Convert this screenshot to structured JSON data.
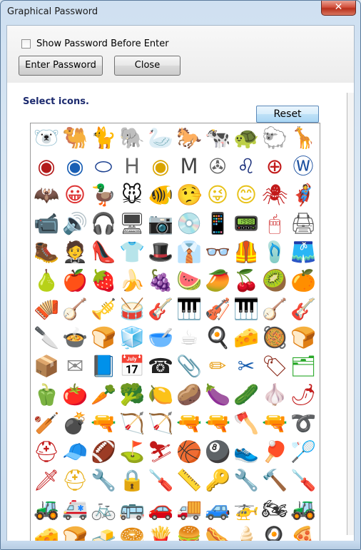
{
  "window": {
    "title": "Graphical Password",
    "close_glyph": "✕"
  },
  "controls": {
    "show_password_label": "Show Password Before Enter",
    "show_password_checked": false,
    "enter_label": "Enter Password",
    "close_label": "Close"
  },
  "panel": {
    "select_label": "Select icons.",
    "reset_label": "Reset"
  },
  "icons": [
    {
      "name": "polar-bear-icon",
      "glyph": "🐻‍❄️",
      "color": "#777"
    },
    {
      "name": "camel-icon",
      "glyph": "🐫",
      "color": "#8a5a2b"
    },
    {
      "name": "cat-icon",
      "glyph": "🐈",
      "color": "#888"
    },
    {
      "name": "elephant-icon",
      "glyph": "🐘",
      "color": "#888"
    },
    {
      "name": "swan-icon",
      "glyph": "🦢",
      "color": "#999"
    },
    {
      "name": "horse-icon",
      "glyph": "🐎",
      "color": "#5a3a1a"
    },
    {
      "name": "cow-icon",
      "glyph": "🐄",
      "color": "#222"
    },
    {
      "name": "turtle-icon",
      "glyph": "🐢",
      "color": "#3a7a2a"
    },
    {
      "name": "sheep-icon",
      "glyph": "🐑",
      "color": "#999"
    },
    {
      "name": "giraffe-icon",
      "glyph": "🦒",
      "color": "#c08a2a"
    },
    {
      "name": "alfa-romeo-logo-icon",
      "glyph": "◉",
      "color": "#b31b1b"
    },
    {
      "name": "bmw-logo-icon",
      "glyph": "◉",
      "color": "#1a5fb4"
    },
    {
      "name": "ford-logo-icon",
      "glyph": "⬭",
      "color": "#1a3f8f"
    },
    {
      "name": "honda-logo-icon",
      "glyph": "H",
      "color": "#666"
    },
    {
      "name": "lotus-logo-icon",
      "glyph": "◉",
      "color": "#d9a400"
    },
    {
      "name": "mazda-logo-icon",
      "glyph": "M",
      "color": "#444"
    },
    {
      "name": "mercedes-logo-icon",
      "glyph": "✇",
      "color": "#666"
    },
    {
      "name": "peugeot-logo-icon",
      "glyph": "♌",
      "color": "#1a2f7a"
    },
    {
      "name": "toyota-logo-icon",
      "glyph": "⊕",
      "color": "#c21a1a"
    },
    {
      "name": "volkswagen-logo-icon",
      "glyph": "Ⓦ",
      "color": "#1a4f9f"
    },
    {
      "name": "batman-icon",
      "glyph": "🦇",
      "color": "#111"
    },
    {
      "name": "cartman-icon",
      "glyph": "😀",
      "color": "#d33"
    },
    {
      "name": "donald-duck-icon",
      "glyph": "🦆",
      "color": "#2a5fb0"
    },
    {
      "name": "mickey-mouse-icon",
      "glyph": "🐭",
      "color": "#111"
    },
    {
      "name": "nemo-fish-icon",
      "glyph": "🐠",
      "color": "#e8671a"
    },
    {
      "name": "pinocchio-icon",
      "glyph": "🤥",
      "color": "#c5741a"
    },
    {
      "name": "bart-simpson-icon",
      "glyph": "😜",
      "color": "#e8c21a"
    },
    {
      "name": "lisa-simpson-icon",
      "glyph": "😊",
      "color": "#e8c21a"
    },
    {
      "name": "spiderman-icon",
      "glyph": "🕷",
      "color": "#c21a1a"
    },
    {
      "name": "superman-icon",
      "glyph": "🦸",
      "color": "#1a4fb0"
    },
    {
      "name": "camcorder-icon",
      "glyph": "📹",
      "color": "#333"
    },
    {
      "name": "speakers-icon",
      "glyph": "🔊",
      "color": "#222"
    },
    {
      "name": "headphones-icon",
      "glyph": "🎧",
      "color": "#333"
    },
    {
      "name": "monitor-icon",
      "glyph": "🖥",
      "color": "#444"
    },
    {
      "name": "camera-icon",
      "glyph": "📷",
      "color": "#222"
    },
    {
      "name": "cd-icon",
      "glyph": "💿",
      "color": "#aaa"
    },
    {
      "name": "ipod-icon",
      "glyph": "📱",
      "color": "#ccc"
    },
    {
      "name": "phone-icon",
      "glyph": "📟",
      "color": "#333"
    },
    {
      "name": "mouse-icon",
      "glyph": "🖱",
      "color": "#c22"
    },
    {
      "name": "printer-icon",
      "glyph": "🖨",
      "color": "#555"
    },
    {
      "name": "boot-icon",
      "glyph": "🥾",
      "color": "#333"
    },
    {
      "name": "tuxedo-icon",
      "glyph": "🤵",
      "color": "#111"
    },
    {
      "name": "high-heel-icon",
      "glyph": "👠",
      "color": "#111"
    },
    {
      "name": "shirt-icon",
      "glyph": "👕",
      "color": "#ccc"
    },
    {
      "name": "hat-icon",
      "glyph": "🎩",
      "color": "#6a3a1a"
    },
    {
      "name": "tie-icon",
      "glyph": "👔",
      "color": "#8a1a1a"
    },
    {
      "name": "glasses-icon",
      "glyph": "👓",
      "color": "#666"
    },
    {
      "name": "life-vest-icon",
      "glyph": "🦺",
      "color": "#f08a1a"
    },
    {
      "name": "flip-flops-icon",
      "glyph": "🩴",
      "color": "#2aa82a"
    },
    {
      "name": "shorts-icon",
      "glyph": "🩳",
      "color": "#666"
    },
    {
      "name": "pear-icon",
      "glyph": "🍐",
      "color": "#b0a030"
    },
    {
      "name": "apple-icon",
      "glyph": "🍎",
      "color": "#c2441a"
    },
    {
      "name": "strawberry-icon",
      "glyph": "🍓",
      "color": "#c21a1a"
    },
    {
      "name": "banana-icon",
      "glyph": "🍌",
      "color": "#e8c21a"
    },
    {
      "name": "grapes-icon",
      "glyph": "🍇",
      "color": "#8a2a8a"
    },
    {
      "name": "watermelon-icon",
      "glyph": "🍉",
      "color": "#e8441a"
    },
    {
      "name": "papaya-icon",
      "glyph": "🥭",
      "color": "#e8a01a"
    },
    {
      "name": "cherries-icon",
      "glyph": "🍒",
      "color": "#8a1a1a"
    },
    {
      "name": "kiwi-icon",
      "glyph": "🥝",
      "color": "#6a8a1a"
    },
    {
      "name": "orange-icon",
      "glyph": "🍊",
      "color": "#f08a1a"
    },
    {
      "name": "accordion-icon",
      "glyph": "🪗",
      "color": "#333"
    },
    {
      "name": "banjo-icon",
      "glyph": "🪕",
      "color": "#8a5a2a"
    },
    {
      "name": "trumpet-icon",
      "glyph": "🎺",
      "color": "#222"
    },
    {
      "name": "drum-icon",
      "glyph": "🥁",
      "color": "#8a6a3a"
    },
    {
      "name": "guitar-icon",
      "glyph": "🎸",
      "color": "#c57a1a"
    },
    {
      "name": "keyboard-icon",
      "glyph": "🎹",
      "color": "#333"
    },
    {
      "name": "violin-icon",
      "glyph": "🎻",
      "color": "#8a3a1a"
    },
    {
      "name": "piano-icon",
      "glyph": "🎹",
      "color": "#111"
    },
    {
      "name": "lute-icon",
      "glyph": "🪕",
      "color": "#6a3a1a"
    },
    {
      "name": "mandolin-icon",
      "glyph": "🎸",
      "color": "#a05a1a"
    },
    {
      "name": "knife-icon",
      "glyph": "🔪",
      "color": "#555"
    },
    {
      "name": "pot-icon",
      "glyph": "🍲",
      "color": "#999"
    },
    {
      "name": "toaster-icon",
      "glyph": "🍞",
      "color": "#aaa"
    },
    {
      "name": "fridge-icon",
      "glyph": "🧊",
      "color": "#ccc"
    },
    {
      "name": "mixer-icon",
      "glyph": "🥣",
      "color": "#ccc"
    },
    {
      "name": "mug-icon",
      "glyph": "☕",
      "color": "#ccc"
    },
    {
      "name": "frying-pan-icon",
      "glyph": "🍳",
      "color": "#1a5fb0"
    },
    {
      "name": "grater-icon",
      "glyph": "🧀",
      "color": "#2aa82a"
    },
    {
      "name": "saucepan-icon",
      "glyph": "🥘",
      "color": "#999"
    },
    {
      "name": "toaster-oven-icon",
      "glyph": "🍞",
      "color": "#aaa"
    },
    {
      "name": "box-icon",
      "glyph": "📦",
      "color": "#8a2a1a"
    },
    {
      "name": "envelope-icon",
      "glyph": "✉",
      "color": "#888"
    },
    {
      "name": "book-icon",
      "glyph": "📘",
      "color": "#444"
    },
    {
      "name": "calendar-icon",
      "glyph": "📅",
      "color": "#c21a1a"
    },
    {
      "name": "telephone-icon",
      "glyph": "☎",
      "color": "#222"
    },
    {
      "name": "paper-clip-icon",
      "glyph": "📎",
      "color": "#999"
    },
    {
      "name": "pencil-icon",
      "glyph": "✏",
      "color": "#e8a01a"
    },
    {
      "name": "scissors-icon",
      "glyph": "✂",
      "color": "#1a5fb0"
    },
    {
      "name": "stamp-icon",
      "glyph": "🏷",
      "color": "#8a2a1a"
    },
    {
      "name": "stapler-icon",
      "glyph": "🗂",
      "color": "#2aa82a"
    },
    {
      "name": "bell-pepper-icon",
      "glyph": "🫑",
      "color": "#c21a1a"
    },
    {
      "name": "tomato-icon",
      "glyph": "🍅",
      "color": "#d22a1a"
    },
    {
      "name": "carrots-icon",
      "glyph": "🥕",
      "color": "#e8671a"
    },
    {
      "name": "cauliflower-icon",
      "glyph": "🥦",
      "color": "#bbb"
    },
    {
      "name": "lemon-icon",
      "glyph": "🍋",
      "color": "#c8c21a"
    },
    {
      "name": "potatoes-icon",
      "glyph": "🥔",
      "color": "#b08a3a"
    },
    {
      "name": "eggplant-icon",
      "glyph": "🍆",
      "color": "#3a1a4a"
    },
    {
      "name": "cucumber-icon",
      "glyph": "🥒",
      "color": "#2a8a2a"
    },
    {
      "name": "garlic-icon",
      "glyph": "🧄",
      "color": "#ccc"
    },
    {
      "name": "chili-icon",
      "glyph": "🌶",
      "color": "#c21a1a"
    },
    {
      "name": "baseball-bat-icon",
      "glyph": "🏏",
      "color": "#555"
    },
    {
      "name": "bomb-icon",
      "glyph": "💣",
      "color": "#111"
    },
    {
      "name": "rifle-icon",
      "glyph": "🔫",
      "color": "#444"
    },
    {
      "name": "bow-icon",
      "glyph": "🏹",
      "color": "#6a3a1a"
    },
    {
      "name": "crossbow-icon",
      "glyph": "🏹",
      "color": "#444"
    },
    {
      "name": "musket-icon",
      "glyph": "🔫",
      "color": "#333"
    },
    {
      "name": "revolver-icon",
      "glyph": "🔫",
      "color": "#555"
    },
    {
      "name": "axe-icon",
      "glyph": "🪓",
      "color": "#666"
    },
    {
      "name": "uzi-icon",
      "glyph": "🔫",
      "color": "#222"
    },
    {
      "name": "whip-icon",
      "glyph": "➰",
      "color": "#6a3a1a"
    },
    {
      "name": "motorcycle-helmet-icon",
      "glyph": "⛑",
      "color": "#c21a1a"
    },
    {
      "name": "baseball-cap-icon",
      "glyph": "🧢",
      "color": "#1a5fb0"
    },
    {
      "name": "football-icon",
      "glyph": "🏈",
      "color": "#7a3a1a"
    },
    {
      "name": "golf-ball-icon",
      "glyph": "⛳",
      "color": "#999"
    },
    {
      "name": "skier-icon",
      "glyph": "⛷",
      "color": "#c21a1a"
    },
    {
      "name": "basketball-icon",
      "glyph": "🏀",
      "color": "#e8671a"
    },
    {
      "name": "eight-ball-icon",
      "glyph": "🎱",
      "color": "#111"
    },
    {
      "name": "sneakers-icon",
      "glyph": "👟",
      "color": "#888"
    },
    {
      "name": "ping-pong-icon",
      "glyph": "🏓",
      "color": "#c21a1a"
    },
    {
      "name": "badminton-icon",
      "glyph": "🏸",
      "color": "#8a8a1a"
    },
    {
      "name": "swiss-knife-icon",
      "glyph": "🗡",
      "color": "#c21a1a"
    },
    {
      "name": "hard-hat-icon",
      "glyph": "⛑",
      "color": "#e8b01a"
    },
    {
      "name": "wrench-icon",
      "glyph": "🔧",
      "color": "#888"
    },
    {
      "name": "padlock-icon",
      "glyph": "🔒",
      "color": "#c8a01a"
    },
    {
      "name": "drill-icon",
      "glyph": "🪛",
      "color": "#e8b01a"
    },
    {
      "name": "tape-measure-icon",
      "glyph": "📏",
      "color": "#e8c21a"
    },
    {
      "name": "keys-icon",
      "glyph": "🔑",
      "color": "#888"
    },
    {
      "name": "pipe-wrench-icon",
      "glyph": "🔧",
      "color": "#c21a1a"
    },
    {
      "name": "hammer-icon",
      "glyph": "🔨",
      "color": "#666"
    },
    {
      "name": "screwdriver-icon",
      "glyph": "🪛",
      "color": "#c21a1a"
    },
    {
      "name": "bulldozer-icon",
      "glyph": "🚜",
      "color": "#e8b01a"
    },
    {
      "name": "ambulance-icon",
      "glyph": "🚑",
      "color": "#c21a1a"
    },
    {
      "name": "bicycle-icon",
      "glyph": "🚲",
      "color": "#444"
    },
    {
      "name": "bus-icon",
      "glyph": "🚌",
      "color": "#1a3f8f"
    },
    {
      "name": "red-car-icon",
      "glyph": "🚗",
      "color": "#c21a1a"
    },
    {
      "name": "truck-icon",
      "glyph": "🚚",
      "color": "#c21a1a"
    },
    {
      "name": "green-car-icon",
      "glyph": "🚙",
      "color": "#2a8a2a"
    },
    {
      "name": "helicopter-icon",
      "glyph": "🚁",
      "color": "#c21a1a"
    },
    {
      "name": "motorcycle-icon",
      "glyph": "🏍",
      "color": "#333"
    },
    {
      "name": "tractor-icon",
      "glyph": "🚜",
      "color": "#2a6a2a"
    },
    {
      "name": "cheese-icon",
      "glyph": "🧀",
      "color": "#e8d01a"
    },
    {
      "name": "toast-icon",
      "glyph": "🍞",
      "color": "#c57a1a"
    },
    {
      "name": "butter-icon",
      "glyph": "🧈",
      "color": "#e8d01a"
    },
    {
      "name": "bagel-icon",
      "glyph": "🥯",
      "color": "#c5841a"
    },
    {
      "name": "fries-icon",
      "glyph": "🍟",
      "color": "#e8b01a"
    },
    {
      "name": "burger-icon",
      "glyph": "🍔",
      "color": "#a05a1a"
    },
    {
      "name": "hot-dog-icon",
      "glyph": "🌭",
      "color": "#c5541a"
    },
    {
      "name": "ice-cream-icon",
      "glyph": "🍦",
      "color": "#c5841a"
    },
    {
      "name": "fried-egg-icon",
      "glyph": "🍳",
      "color": "#e8c21a"
    },
    {
      "name": "pizza-icon",
      "glyph": "🍕",
      "color": "#e8a01a"
    }
  ]
}
